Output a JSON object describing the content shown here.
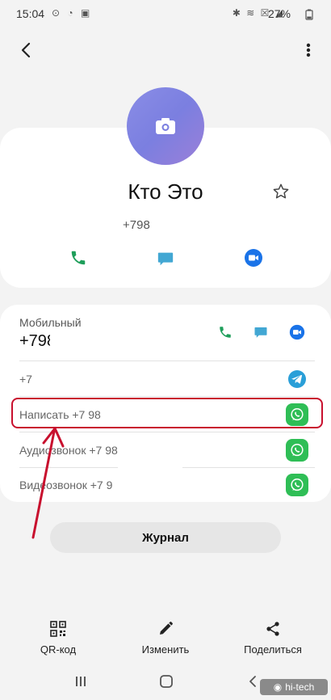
{
  "status_bar": {
    "time": "15:04",
    "battery": "27%"
  },
  "contact": {
    "name": "Кто Это",
    "number_visible": "+798"
  },
  "details": {
    "mobile_label": "Мобильный",
    "mobile_number": "+798",
    "telegram_number": "+7",
    "whatsapp_write": "Написать +7 98",
    "whatsapp_audio": "Аудиозвонок +7 98",
    "whatsapp_video": "Видеозвонок +7 9"
  },
  "journal": {
    "label": "Журнал"
  },
  "toolbar": {
    "qr_label": "QR-код",
    "edit_label": "Изменить",
    "share_label": "Поделиться"
  },
  "watermark": {
    "text": "hi-tech"
  },
  "colors": {
    "call_green": "#1e9e5a",
    "message_teal": "#42a7d3",
    "video_blue": "#1a73e8",
    "whatsapp_green": "#2fbe56",
    "telegram_blue": "#2a9fd8",
    "highlight_red": "#c8102e",
    "avatar_purple": "#7b7fe0"
  }
}
